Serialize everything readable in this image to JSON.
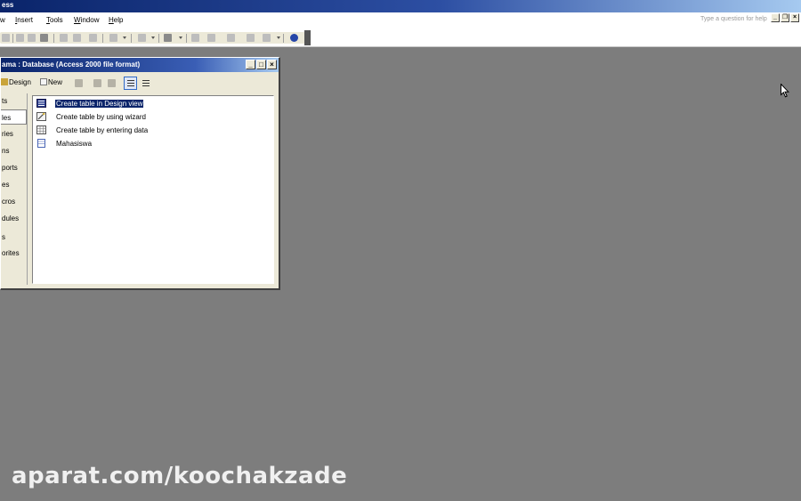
{
  "app": {
    "title": "ess"
  },
  "menubar": {
    "items": [
      {
        "pre": "",
        "u": "",
        "post": "w"
      },
      {
        "pre": "",
        "u": "I",
        "post": "nsert"
      },
      {
        "pre": "",
        "u": "T",
        "post": "ools"
      },
      {
        "pre": "",
        "u": "W",
        "post": "indow"
      },
      {
        "pre": "",
        "u": "H",
        "post": "elp"
      }
    ],
    "ask_placeholder": "Type a question for help"
  },
  "mdi_buttons": [
    "_",
    "❐",
    "×"
  ],
  "database_window": {
    "title": "ama : Database (Access 2000 file format)",
    "buttons": [
      "_",
      "□",
      "×"
    ],
    "toolbar": {
      "design_label": "Design",
      "new_label": "New"
    },
    "objects": [
      {
        "label": "ts",
        "active": false
      },
      {
        "label": "les",
        "active": true
      },
      {
        "label": "ries",
        "active": false
      },
      {
        "label": "ns",
        "active": false
      },
      {
        "label": "ports",
        "active": false
      },
      {
        "label": "es",
        "active": false
      },
      {
        "label": "cros",
        "active": false
      },
      {
        "label": "dules",
        "active": false
      },
      {
        "label": "s",
        "active": false
      },
      {
        "label": "orites",
        "active": false
      }
    ],
    "list": [
      {
        "label": "Create table in Design view",
        "icon": "design-view-icon",
        "selected": true
      },
      {
        "label": "Create table by using wizard",
        "icon": "wizard-icon",
        "selected": false
      },
      {
        "label": "Create table by entering data",
        "icon": "datasheet-icon",
        "selected": false
      },
      {
        "label": "Mahasiswa",
        "icon": "table-icon",
        "selected": false
      }
    ]
  },
  "watermark": "aparat.com/koochakzade",
  "colors": {
    "desktop": "#7d7d7d",
    "title_blue": "#0a246a",
    "selection": "#0a246a"
  }
}
